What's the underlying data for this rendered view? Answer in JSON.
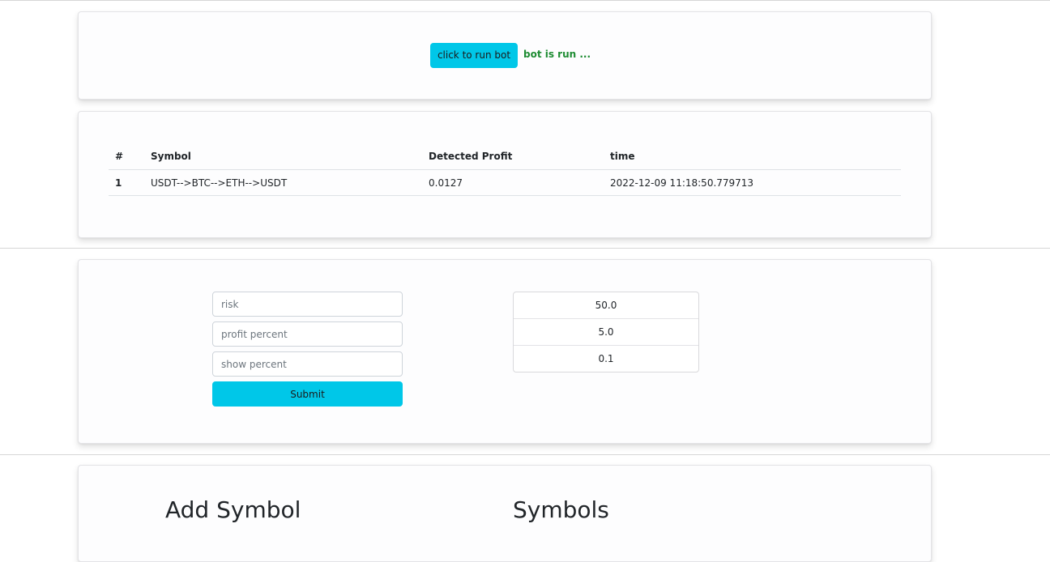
{
  "bot_panel": {
    "run_button_label": "click to run bot",
    "status_text": "bot is run ..."
  },
  "results_table": {
    "headers": [
      "#",
      "Symbol",
      "Detected Profit",
      "time"
    ],
    "rows": [
      {
        "index": "1",
        "symbol": "USDT-->BTC-->ETH-->USDT",
        "profit": "0.0127",
        "time": "2022-12-09 11:18:50.779713"
      }
    ]
  },
  "settings_form": {
    "risk_placeholder": "risk",
    "profit_percent_placeholder": "profit percent",
    "show_percent_placeholder": "show percent",
    "submit_label": "Submit"
  },
  "current_settings": {
    "values": [
      "50.0",
      "5.0",
      "0.1"
    ]
  },
  "symbols_panel": {
    "add_symbol_title": "Add Symbol",
    "symbols_title": "Symbols"
  },
  "colors": {
    "accent": "#00c7e8",
    "status": "#1e8c33"
  }
}
